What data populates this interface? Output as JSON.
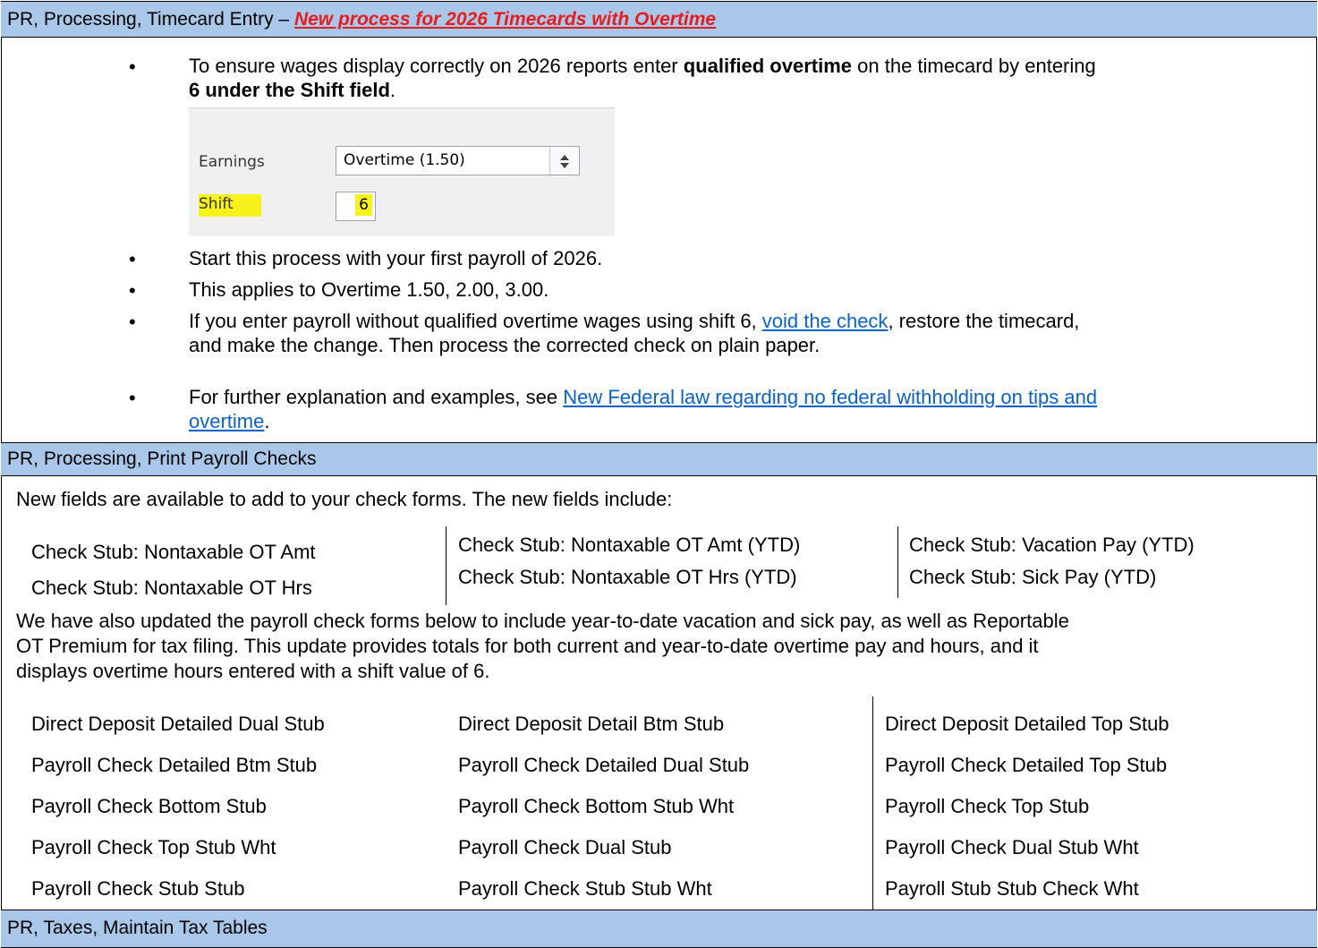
{
  "section1": {
    "title_prefix": "PR, Processing, Timecard Entry – ",
    "title_highlight": "New process for 2026 Timecards with Overtime"
  },
  "bullets": {
    "b1_part1": "To ensure wages display correctly on 2026 reports enter ",
    "b1_bold1": "qualified overtime",
    "b1_part2": " on the timecard by entering",
    "b1_bold2": "6 under the Shift field",
    "b1_end": ".",
    "b2": "Start this process with your first payroll of 2026.",
    "b3": "This applies to Overtime 1.50, 2.00, 3.00.",
    "b4_part1": "If you enter payroll without qualified overtime wages using shift 6, ",
    "b4_link": "void the check",
    "b4_part2": ", restore the timecard,",
    "b4_line2": "and make the change. Then process the corrected check on plain paper.",
    "b5_part1": "For further explanation and examples, see ",
    "b5_link1": "New Federal law regarding no federal withholding on tips and",
    "b5_link2": "overtime",
    "b5_end": "."
  },
  "screenshot": {
    "earnings_label": "Earnings",
    "earnings_value": "Overtime (1.50)",
    "shift_label": "Shift",
    "shift_value": "6"
  },
  "section2": {
    "title": "PR, Processing, Print Payroll Checks",
    "intro": "New fields are available to add to your check forms. The new fields include:",
    "fields": [
      [
        "Check Stub: Nontaxable OT Amt",
        "Check Stub: Nontaxable OT Hrs"
      ],
      [
        "Check Stub: Nontaxable OT Amt (YTD)",
        "Check Stub: Nontaxable OT Hrs (YTD)"
      ],
      [
        "Check Stub: Vacation Pay (YTD)",
        "Check Stub: Sick Pay (YTD)"
      ]
    ],
    "para_line1": "We have also updated the payroll check forms below to include year-to-date vacation and sick pay, as well as Reportable",
    "para_line2": "OT Premium for tax filing. This update provides totals for both current and year-to-date overtime pay and hours, and it",
    "para_line3": "displays overtime hours entered with a shift value of 6.",
    "forms": [
      [
        "Direct Deposit Detailed Dual Stub",
        "Direct Deposit Detail Btm Stub",
        "Direct Deposit Detailed Top Stub"
      ],
      [
        "Payroll Check Detailed Btm Stub",
        "Payroll Check Detailed Dual Stub",
        "Payroll Check Detailed Top Stub"
      ],
      [
        "Payroll Check Bottom Stub",
        "Payroll Check Bottom Stub Wht",
        "Payroll Check Top Stub"
      ],
      [
        "Payroll Check Top Stub Wht",
        "Payroll Check Dual Stub",
        "Payroll Check Dual Stub Wht"
      ],
      [
        "Payroll Check Stub Stub",
        "Payroll Check Stub Stub Wht",
        "Payroll Stub Stub Check Wht"
      ]
    ]
  },
  "section3": {
    "title": "PR, Taxes, Maintain Tax Tables"
  }
}
